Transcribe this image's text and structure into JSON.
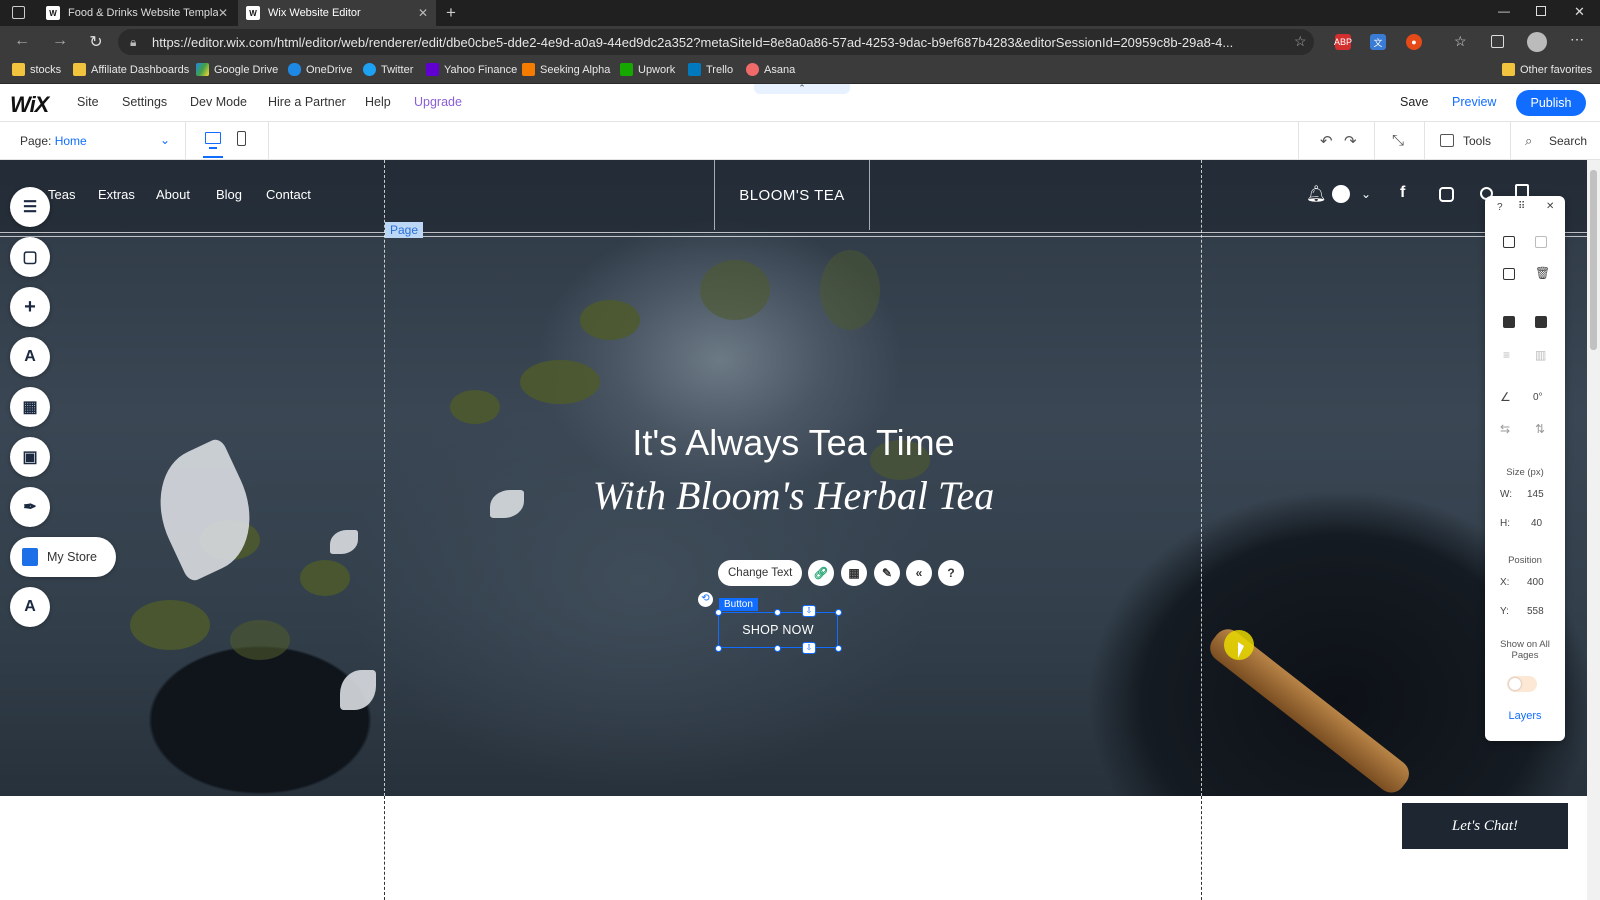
{
  "browser": {
    "tabs": [
      {
        "label": "Food & Drinks Website Templat",
        "favicon": "W"
      },
      {
        "label": "Wix Website Editor",
        "favicon": "W"
      }
    ],
    "url": "https://editor.wix.com/html/editor/web/renderer/edit/dbe0cbe5-dde2-4e9d-a0a9-44ed9dc2a352?metaSiteId=8e8a0a86-57ad-4253-9dac-b9ef687b4283&editorSessionId=20959c8b-29a8-4...",
    "bookmarks": [
      "stocks",
      "Affiliate Dashboards",
      "Google Drive",
      "OneDrive",
      "Twitter",
      "Yahoo Finance",
      "Seeking Alpha",
      "Upwork",
      "Trello",
      "Asana"
    ],
    "other_favorites": "Other favorites"
  },
  "wix": {
    "logo": "WiX",
    "menu": [
      "Site",
      "Settings",
      "Dev Mode",
      "Hire a Partner",
      "Help",
      "Upgrade"
    ],
    "save": "Save",
    "preview": "Preview",
    "publish": "Publish",
    "page_label": "Page:",
    "page_value": "Home",
    "tools": "Tools",
    "search": "Search"
  },
  "site": {
    "nav": [
      "Teas",
      "Extras",
      "About",
      "Blog",
      "Contact"
    ],
    "logo": "BLOOM'S TEA",
    "page_tag": "Page",
    "headline1": "It's Always Tea Time",
    "headline2": "With Bloom's Herbal Tea",
    "button_tag": "Button",
    "button_text": "SHOP NOW",
    "lets_chat": "Let's Chat!"
  },
  "element_toolbar": {
    "change_text": "Change Text"
  },
  "left_rail": {
    "my_store": "My Store"
  },
  "right_panel": {
    "rotation": "0°",
    "size_label": "Size (px)",
    "w_label": "W:",
    "w_value": "145",
    "h_label": "H:",
    "h_value": "40",
    "position_label": "Position",
    "x_label": "X:",
    "x_value": "400",
    "y_label": "Y:",
    "y_value": "558",
    "show_all": "Show on All Pages",
    "layers": "Layers"
  }
}
